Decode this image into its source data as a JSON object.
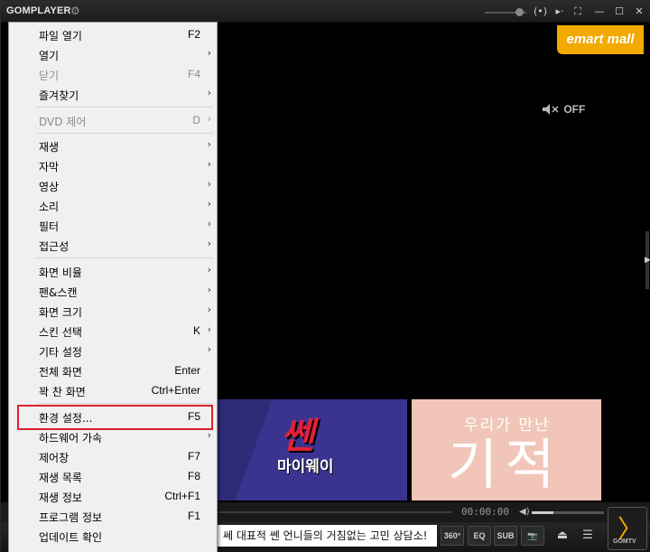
{
  "app": {
    "logo": "GOMPLAYER",
    "title_buttons": [
      "(•)",
      "▸·",
      "⛶",
      "—",
      "☐",
      "✕"
    ]
  },
  "video": {
    "ad_banner": "emart mall",
    "mute_label": "OFF"
  },
  "thumbnails": [
    {
      "title_main": "쎈",
      "title_sub": "마이웨이"
    },
    {
      "title_line1": "우리가 만난",
      "title_line2": "기적"
    }
  ],
  "menu": {
    "items": [
      {
        "label": "파일 열기",
        "shortcut": "F2",
        "submenu": false,
        "disabled": false
      },
      {
        "label": "열기",
        "shortcut": "",
        "submenu": true,
        "disabled": false
      },
      {
        "label": "닫기",
        "shortcut": "F4",
        "submenu": false,
        "disabled": true
      },
      {
        "label": "즐겨찾기",
        "shortcut": "",
        "submenu": true,
        "disabled": false
      },
      {
        "label": "DVD 제어",
        "shortcut": "D",
        "submenu": true,
        "disabled": true
      },
      {
        "label": "재생",
        "shortcut": "",
        "submenu": true,
        "disabled": false
      },
      {
        "label": "자막",
        "shortcut": "",
        "submenu": true,
        "disabled": false
      },
      {
        "label": "영상",
        "shortcut": "",
        "submenu": true,
        "disabled": false
      },
      {
        "label": "소리",
        "shortcut": "",
        "submenu": true,
        "disabled": false
      },
      {
        "label": "필터",
        "shortcut": "",
        "submenu": true,
        "disabled": false
      },
      {
        "label": "접근성",
        "shortcut": "",
        "submenu": true,
        "disabled": false
      },
      {
        "label": "화면 비율",
        "shortcut": "",
        "submenu": true,
        "disabled": false
      },
      {
        "label": "팬&스캔",
        "shortcut": "",
        "submenu": true,
        "disabled": false
      },
      {
        "label": "화면 크기",
        "shortcut": "",
        "submenu": true,
        "disabled": false
      },
      {
        "label": "스킨 선택",
        "shortcut": "K",
        "submenu": true,
        "disabled": false
      },
      {
        "label": "기타 설정",
        "shortcut": "",
        "submenu": true,
        "disabled": false
      },
      {
        "label": "전체 화면",
        "shortcut": "Enter",
        "submenu": false,
        "disabled": false
      },
      {
        "label": "꽉 찬 화면",
        "shortcut": "Ctrl+Enter",
        "submenu": false,
        "disabled": false
      },
      {
        "label": "환경 설정...",
        "shortcut": "F5",
        "submenu": false,
        "disabled": false
      },
      {
        "label": "하드웨어 가속",
        "shortcut": "",
        "submenu": true,
        "disabled": false
      },
      {
        "label": "제어창",
        "shortcut": "F7",
        "submenu": false,
        "disabled": false
      },
      {
        "label": "재생 목록",
        "shortcut": "F8",
        "submenu": false,
        "disabled": false
      },
      {
        "label": "재생 정보",
        "shortcut": "Ctrl+F1",
        "submenu": false,
        "disabled": false
      },
      {
        "label": "프로그램 정보",
        "shortcut": "F1",
        "submenu": false,
        "disabled": false
      },
      {
        "label": "업데이트 확인",
        "shortcut": "",
        "submenu": false,
        "disabled": false
      }
    ]
  },
  "playback": {
    "time": "00:00:00",
    "volume_level": 0.3
  },
  "bottom": {
    "ticker": "쎄 대표적 쎈 언니들의 거침없는 고민 상담소!",
    "btn_360": "360°",
    "btn_eq": "EQ",
    "btn_sub": "SUB",
    "btn_camera": "📷",
    "btn_eject": "⏏",
    "btn_menu": "☰",
    "gomtv_label": "GOMTV"
  },
  "colors": {
    "accent": "#f2a900",
    "highlight": "#e0202e",
    "menu_bg": "#f0f0f0"
  }
}
